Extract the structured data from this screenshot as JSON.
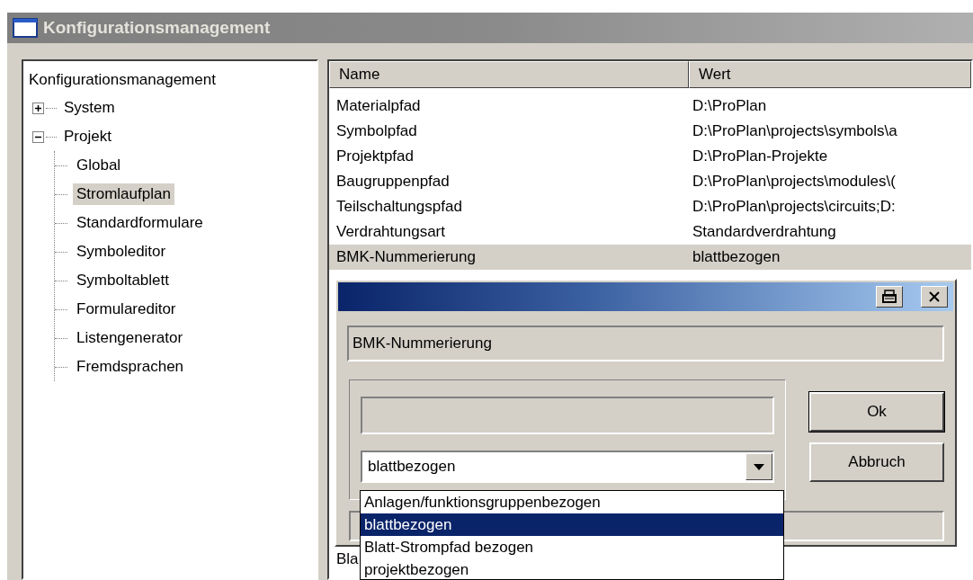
{
  "window": {
    "title": "Konfigurationsmanagement"
  },
  "tree": {
    "label": "Konfigurationsmanagement",
    "children": [
      {
        "label": "System",
        "expanded": false,
        "selected": false
      },
      {
        "label": "Projekt",
        "expanded": true,
        "selected": false,
        "children": [
          {
            "label": "Global",
            "selected": false
          },
          {
            "label": "Stromlaufplan",
            "selected": true
          },
          {
            "label": "Standardformulare",
            "selected": false
          },
          {
            "label": "Symboleditor",
            "selected": false
          },
          {
            "label": "Symboltablett",
            "selected": false
          },
          {
            "label": "Formulareditor",
            "selected": false
          },
          {
            "label": "Listengenerator",
            "selected": false
          },
          {
            "label": "Fremdsprachen",
            "selected": false
          }
        ]
      }
    ]
  },
  "table": {
    "columns": [
      "Name",
      "Wert"
    ],
    "rows": [
      {
        "name": "Materialpfad",
        "value": "D:\\ProPlan",
        "selected": false
      },
      {
        "name": "Symbolpfad",
        "value": "D:\\ProPlan\\projects\\symbols\\a",
        "selected": false
      },
      {
        "name": "Projektpfad",
        "value": "D:\\ProPlan-Projekte",
        "selected": false
      },
      {
        "name": "Baugruppenpfad",
        "value": "D:\\ProPlan\\projects\\modules\\(",
        "selected": false
      },
      {
        "name": "Teilschaltungspfad",
        "value": "D:\\ProPlan\\projects\\circuits;D:",
        "selected": false
      },
      {
        "name": "Verdrahtungsart",
        "value": "Standardverdrahtung",
        "selected": false
      },
      {
        "name": "BMK-Nummerierung",
        "value": "blattbezogen",
        "selected": true
      }
    ],
    "partial_row_text": "Bla"
  },
  "dialog": {
    "name_field": "BMK-Nummerierung",
    "combo_value": "blattbezogen",
    "options": [
      {
        "label": "Anlagen/funktionsgruppenbezogen",
        "selected": false
      },
      {
        "label": "blattbezogen",
        "selected": true
      },
      {
        "label": "Blatt-Strompfad bezogen",
        "selected": false
      },
      {
        "label": "projektbezogen",
        "selected": false
      }
    ],
    "buttons": [
      "Ok",
      "Abbruch"
    ]
  }
}
